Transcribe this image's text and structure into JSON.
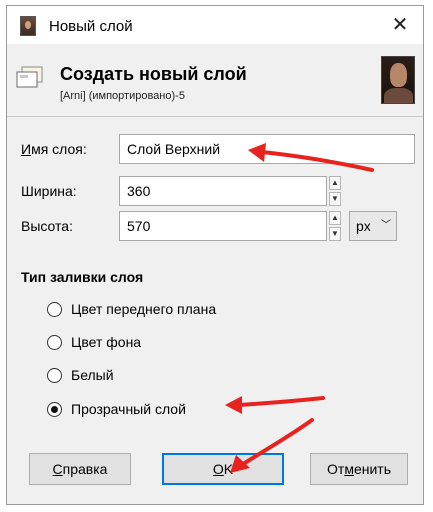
{
  "window": {
    "title": "Новый слой",
    "close_glyph": "✕"
  },
  "header": {
    "title": "Создать новый слой",
    "subtitle": "[Arni] (импортировано)-5"
  },
  "form": {
    "name_label_u": "И",
    "name_label_rest": "мя слоя:",
    "name_value": "Слой Верхний",
    "width_label": "Ширина:",
    "width_value": "360",
    "height_label": "Высота:",
    "height_value": "570",
    "unit": "px"
  },
  "fill": {
    "title": "Тип заливки слоя",
    "options": [
      {
        "label": "Цвет переднего плана",
        "checked": false
      },
      {
        "label": "Цвет фона",
        "checked": false
      },
      {
        "label": "Белый",
        "checked": false
      },
      {
        "label": "Прозрачный слой",
        "checked": true
      }
    ]
  },
  "buttons": {
    "help_u": "С",
    "help_rest": "правка",
    "ok_u": "O",
    "ok_rest": "K",
    "cancel_pre": "От",
    "cancel_u": "м",
    "cancel_rest": "енить"
  },
  "colors": {
    "annotation_arrow": "#e8231f",
    "default_button_border": "#0078d7"
  }
}
